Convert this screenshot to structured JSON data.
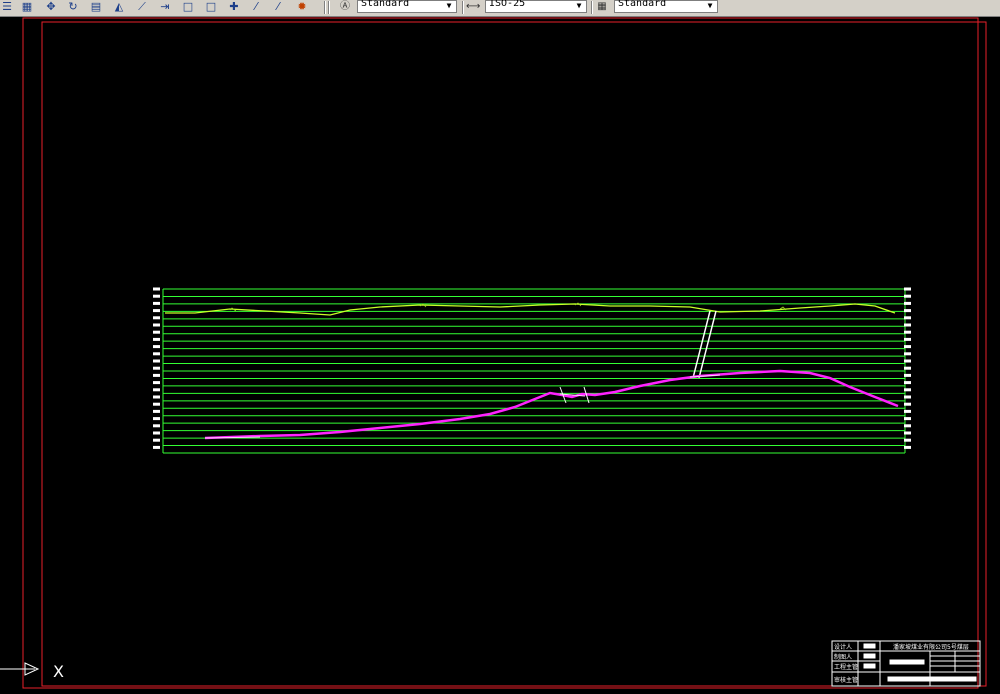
{
  "toolbar": {
    "icons": [
      "align-icon",
      "grid-icon",
      "pan-icon",
      "rotate-icon",
      "block-icon",
      "mirror-icon",
      "trim-icon",
      "extend-icon",
      "rect-icon",
      "rect2-icon",
      "explode-icon",
      "pencil-icon",
      "pencil2-icon",
      "properties-icon"
    ],
    "text_style": {
      "value": "Standard",
      "icon": "text-style-icon"
    },
    "dim_style": {
      "value": "ISO-25",
      "icon": "dimension-style-icon"
    },
    "table_style": {
      "value": "Standard",
      "icon": "table-style-icon"
    }
  },
  "drawing": {
    "colors": {
      "background": "#000000",
      "frame": "#e8202a",
      "grid": "#33ff33",
      "terrain": "#c8ff28",
      "profile": "#ff22ff",
      "tick": "#ffffff"
    },
    "ucs_label": "X",
    "title_block": {
      "header": "潘家坡煤业有限公司5号煤层",
      "rows": [
        "设计人",
        "制图人",
        "工程主管",
        "审核主管"
      ]
    }
  }
}
